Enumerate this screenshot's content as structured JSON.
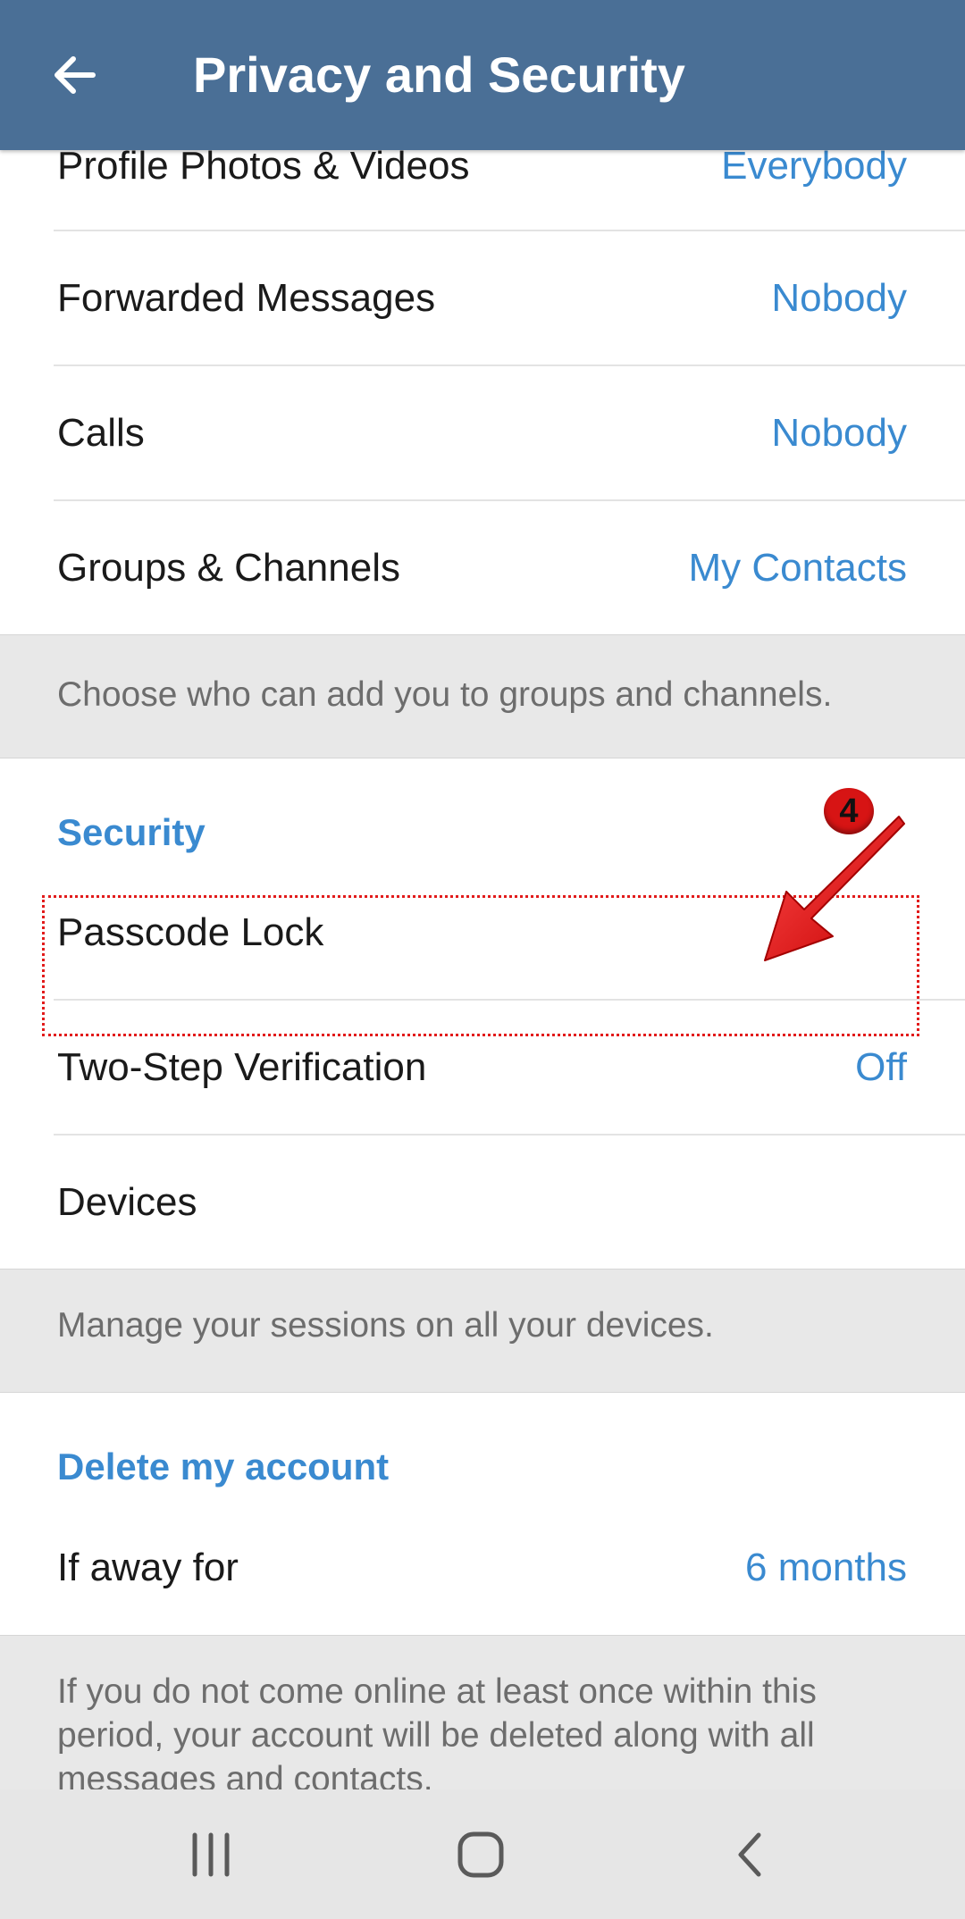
{
  "appbar": {
    "title": "Privacy and Security",
    "back_icon": "arrow-left-icon"
  },
  "privacy_rows": [
    {
      "label": "Profile Photos & Videos",
      "value": "Everybody"
    },
    {
      "label": "Forwarded Messages",
      "value": "Nobody"
    },
    {
      "label": "Calls",
      "value": "Nobody"
    },
    {
      "label": "Groups & Channels",
      "value": "My Contacts"
    }
  ],
  "groups_info": "Choose who can add you to groups and channels.",
  "security": {
    "header": "Security",
    "rows": [
      {
        "label": "Passcode Lock",
        "value": ""
      },
      {
        "label": "Two-Step Verification",
        "value": "Off"
      },
      {
        "label": "Devices",
        "value": ""
      }
    ],
    "info": "Manage your sessions on all your devices."
  },
  "delete_account": {
    "header": "Delete my account",
    "row": {
      "label": "If away for",
      "value": "6 months"
    },
    "info": "If you do not come online at least once within this period, your account will be deleted along with all messages and contacts."
  },
  "annotation": {
    "step_number": "4",
    "color": "#e21b1b"
  },
  "colors": {
    "appbar": "#4a6f96",
    "accent": "#3a8ad0",
    "section_gap": "#e8e8e8"
  },
  "navbar": {
    "icons": [
      "recent-apps-icon",
      "home-icon",
      "back-icon"
    ]
  }
}
